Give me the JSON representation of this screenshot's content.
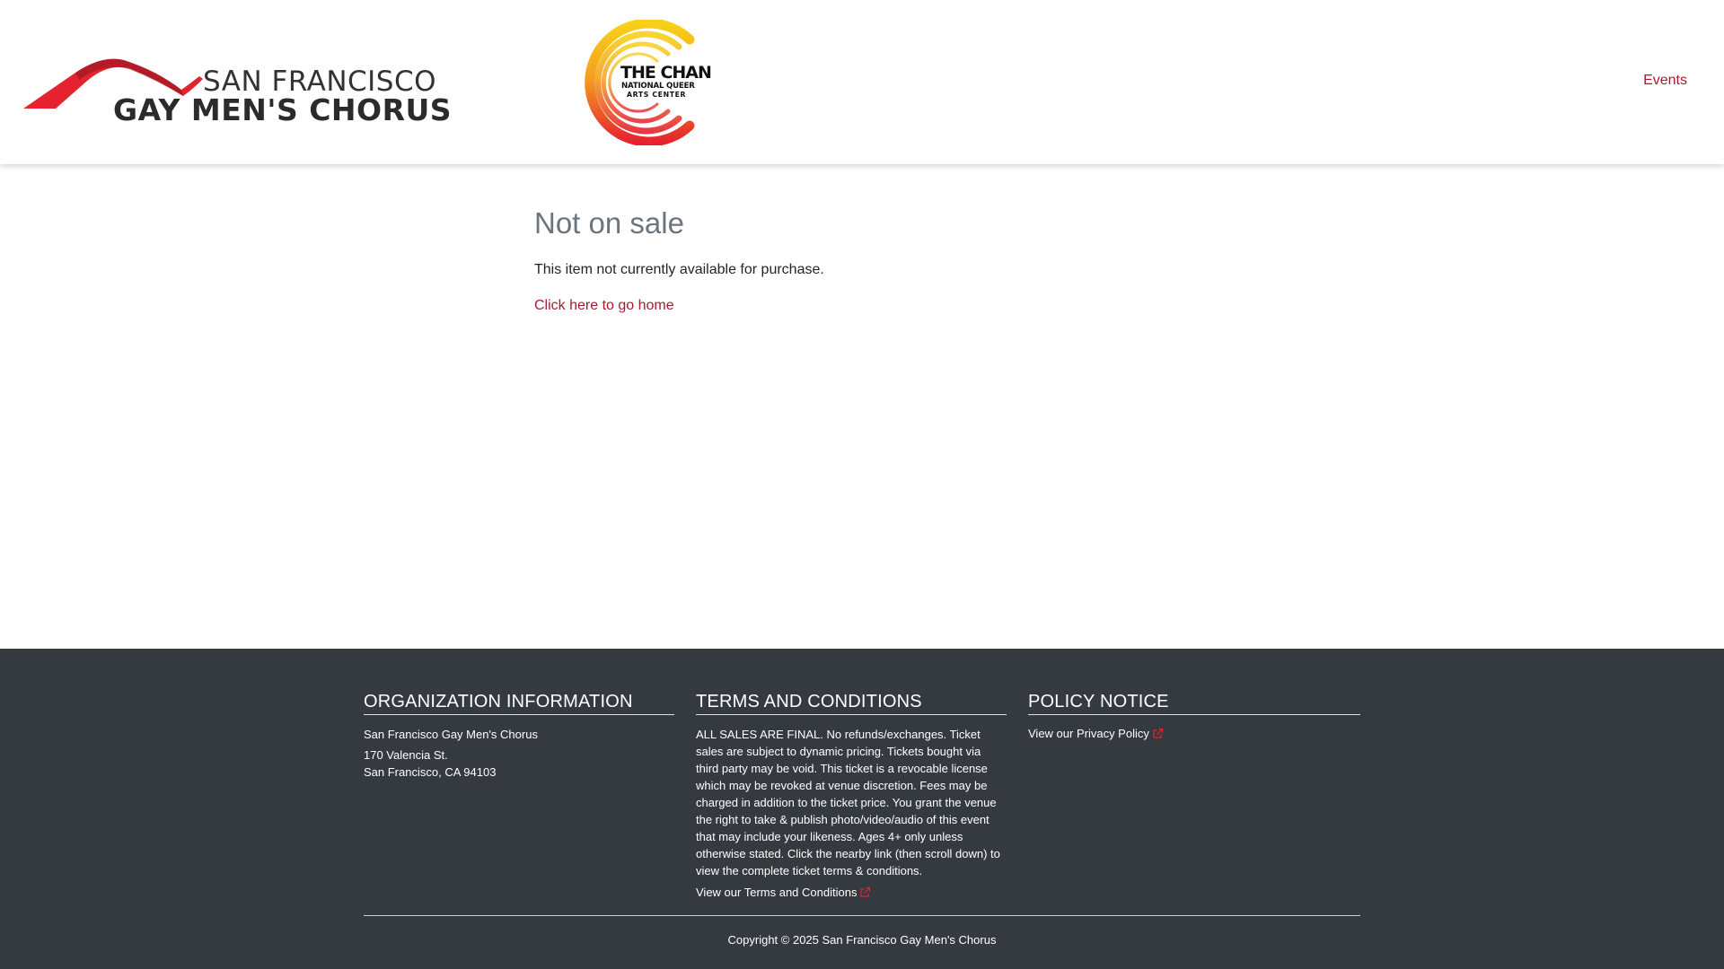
{
  "header": {
    "logo_primary": {
      "line1": "SAN FRANCISCO",
      "line2": "GAY MEN'S CHORUS",
      "accent": "#e5232e"
    },
    "logo_secondary": {
      "line1": "THE CHAN",
      "line2": "NATIONAL QUEER",
      "line3": "ARTS CENTER",
      "colors": [
        "#f7d117",
        "#f4a020",
        "#ef6a1f",
        "#e5232e"
      ]
    },
    "nav": {
      "events_label": "Events"
    }
  },
  "main": {
    "title": "Not on sale",
    "message": "This item not currently available for purchase.",
    "home_link_label": "Click here to go home"
  },
  "footer": {
    "org": {
      "heading": "ORGANIZATION INFORMATION",
      "name": "San Francisco Gay Men's Chorus",
      "address_line1": "170 Valencia St.",
      "address_line2": "San Francisco, CA 94103"
    },
    "terms": {
      "heading": "TERMS AND CONDITIONS",
      "body": "ALL SALES ARE FINAL. No refunds/exchanges. Ticket sales are subject to dynamic pricing. Tickets bought via third party may be void. This ticket is a revocable license which may be revoked at venue discretion. Fees may be charged in addition to the ticket price. You grant the venue the right to take & publish photo/video/audio of this event that may include your likeness. Ages 4+ only unless otherwise stated. Click the nearby link (then scroll down) to view the complete ticket terms & conditions.",
      "link_label": "View our Terms and Conditions",
      "link_icon": "external-link-icon"
    },
    "policy": {
      "heading": "POLICY NOTICE",
      "link_label": "View our Privacy Policy",
      "link_icon": "external-link-icon"
    },
    "copyright": "Copyright © 2025 San Francisco Gay Men's Chorus"
  },
  "colors": {
    "brand_accent": "#a51c30",
    "footer_bg": "#343a40",
    "external_icon": "#e5232e"
  }
}
